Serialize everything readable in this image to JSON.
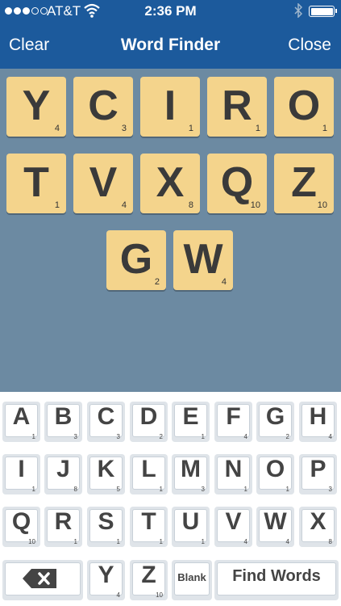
{
  "status": {
    "carrier": "AT&T",
    "time": "2:36 PM"
  },
  "nav": {
    "left": "Clear",
    "title": "Word Finder",
    "right": "Close"
  },
  "board": [
    {
      "letter": "Y",
      "points": "4"
    },
    {
      "letter": "C",
      "points": "3"
    },
    {
      "letter": "I",
      "points": "1"
    },
    {
      "letter": "R",
      "points": "1"
    },
    {
      "letter": "O",
      "points": "1"
    },
    {
      "letter": "T",
      "points": "1"
    },
    {
      "letter": "V",
      "points": "4"
    },
    {
      "letter": "X",
      "points": "8"
    },
    {
      "letter": "Q",
      "points": "10"
    },
    {
      "letter": "Z",
      "points": "10"
    },
    {
      "letter": "G",
      "points": "2"
    },
    {
      "letter": "W",
      "points": "4"
    }
  ],
  "keys": [
    {
      "letter": "A",
      "points": "1"
    },
    {
      "letter": "B",
      "points": "3"
    },
    {
      "letter": "C",
      "points": "3"
    },
    {
      "letter": "D",
      "points": "2"
    },
    {
      "letter": "E",
      "points": "1"
    },
    {
      "letter": "F",
      "points": "4"
    },
    {
      "letter": "G",
      "points": "2"
    },
    {
      "letter": "H",
      "points": "4"
    },
    {
      "letter": "I",
      "points": "1"
    },
    {
      "letter": "J",
      "points": "8"
    },
    {
      "letter": "K",
      "points": "5"
    },
    {
      "letter": "L",
      "points": "1"
    },
    {
      "letter": "M",
      "points": "3"
    },
    {
      "letter": "N",
      "points": "1"
    },
    {
      "letter": "O",
      "points": "1"
    },
    {
      "letter": "P",
      "points": "3"
    },
    {
      "letter": "Q",
      "points": "10"
    },
    {
      "letter": "R",
      "points": "1"
    },
    {
      "letter": "S",
      "points": "1"
    },
    {
      "letter": "T",
      "points": "1"
    },
    {
      "letter": "U",
      "points": "1"
    },
    {
      "letter": "V",
      "points": "4"
    },
    {
      "letter": "W",
      "points": "4"
    },
    {
      "letter": "X",
      "points": "8"
    },
    {
      "letter": "Y",
      "points": "4"
    },
    {
      "letter": "Z",
      "points": "10"
    }
  ],
  "blank_label": "Blank",
  "find_label": "Find Words"
}
